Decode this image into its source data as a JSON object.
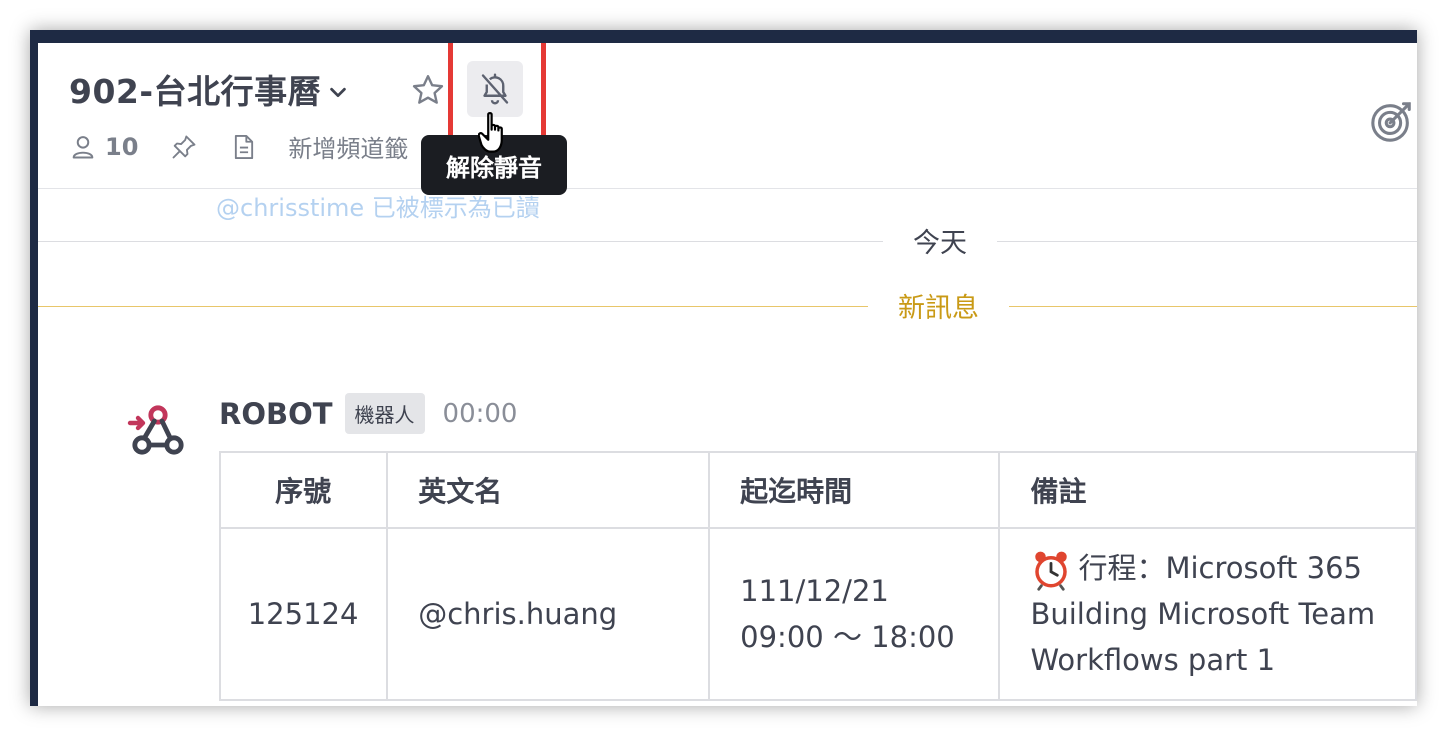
{
  "header": {
    "channel_name": "902-台北行事曆",
    "members_count": "10",
    "add_bookmark": "新增頻道籤",
    "tooltip": "解除靜音"
  },
  "messages": {
    "partial_text": "@chrisstime 已被標示為已讀",
    "today_divider": "今天",
    "new_divider": "新訊息",
    "post": {
      "sender": "ROBOT",
      "badge": "機器人",
      "time": "00:00"
    }
  },
  "table": {
    "headers": [
      "序號",
      "英文名",
      "起迄時間",
      "備註"
    ],
    "rows": [
      {
        "id": "125124",
        "name": "@chris.huang",
        "date": "111/12/21",
        "hours": "09:00 ～ 18:00",
        "note_line1": "行程：Microsoft 365",
        "note_line2": "Building Microsoft Team",
        "note_line3": "Workflows part 1"
      }
    ]
  },
  "colors": {
    "accent_new": "#c99a16",
    "highlight": "#e53935",
    "frame": "#1e2a44"
  }
}
